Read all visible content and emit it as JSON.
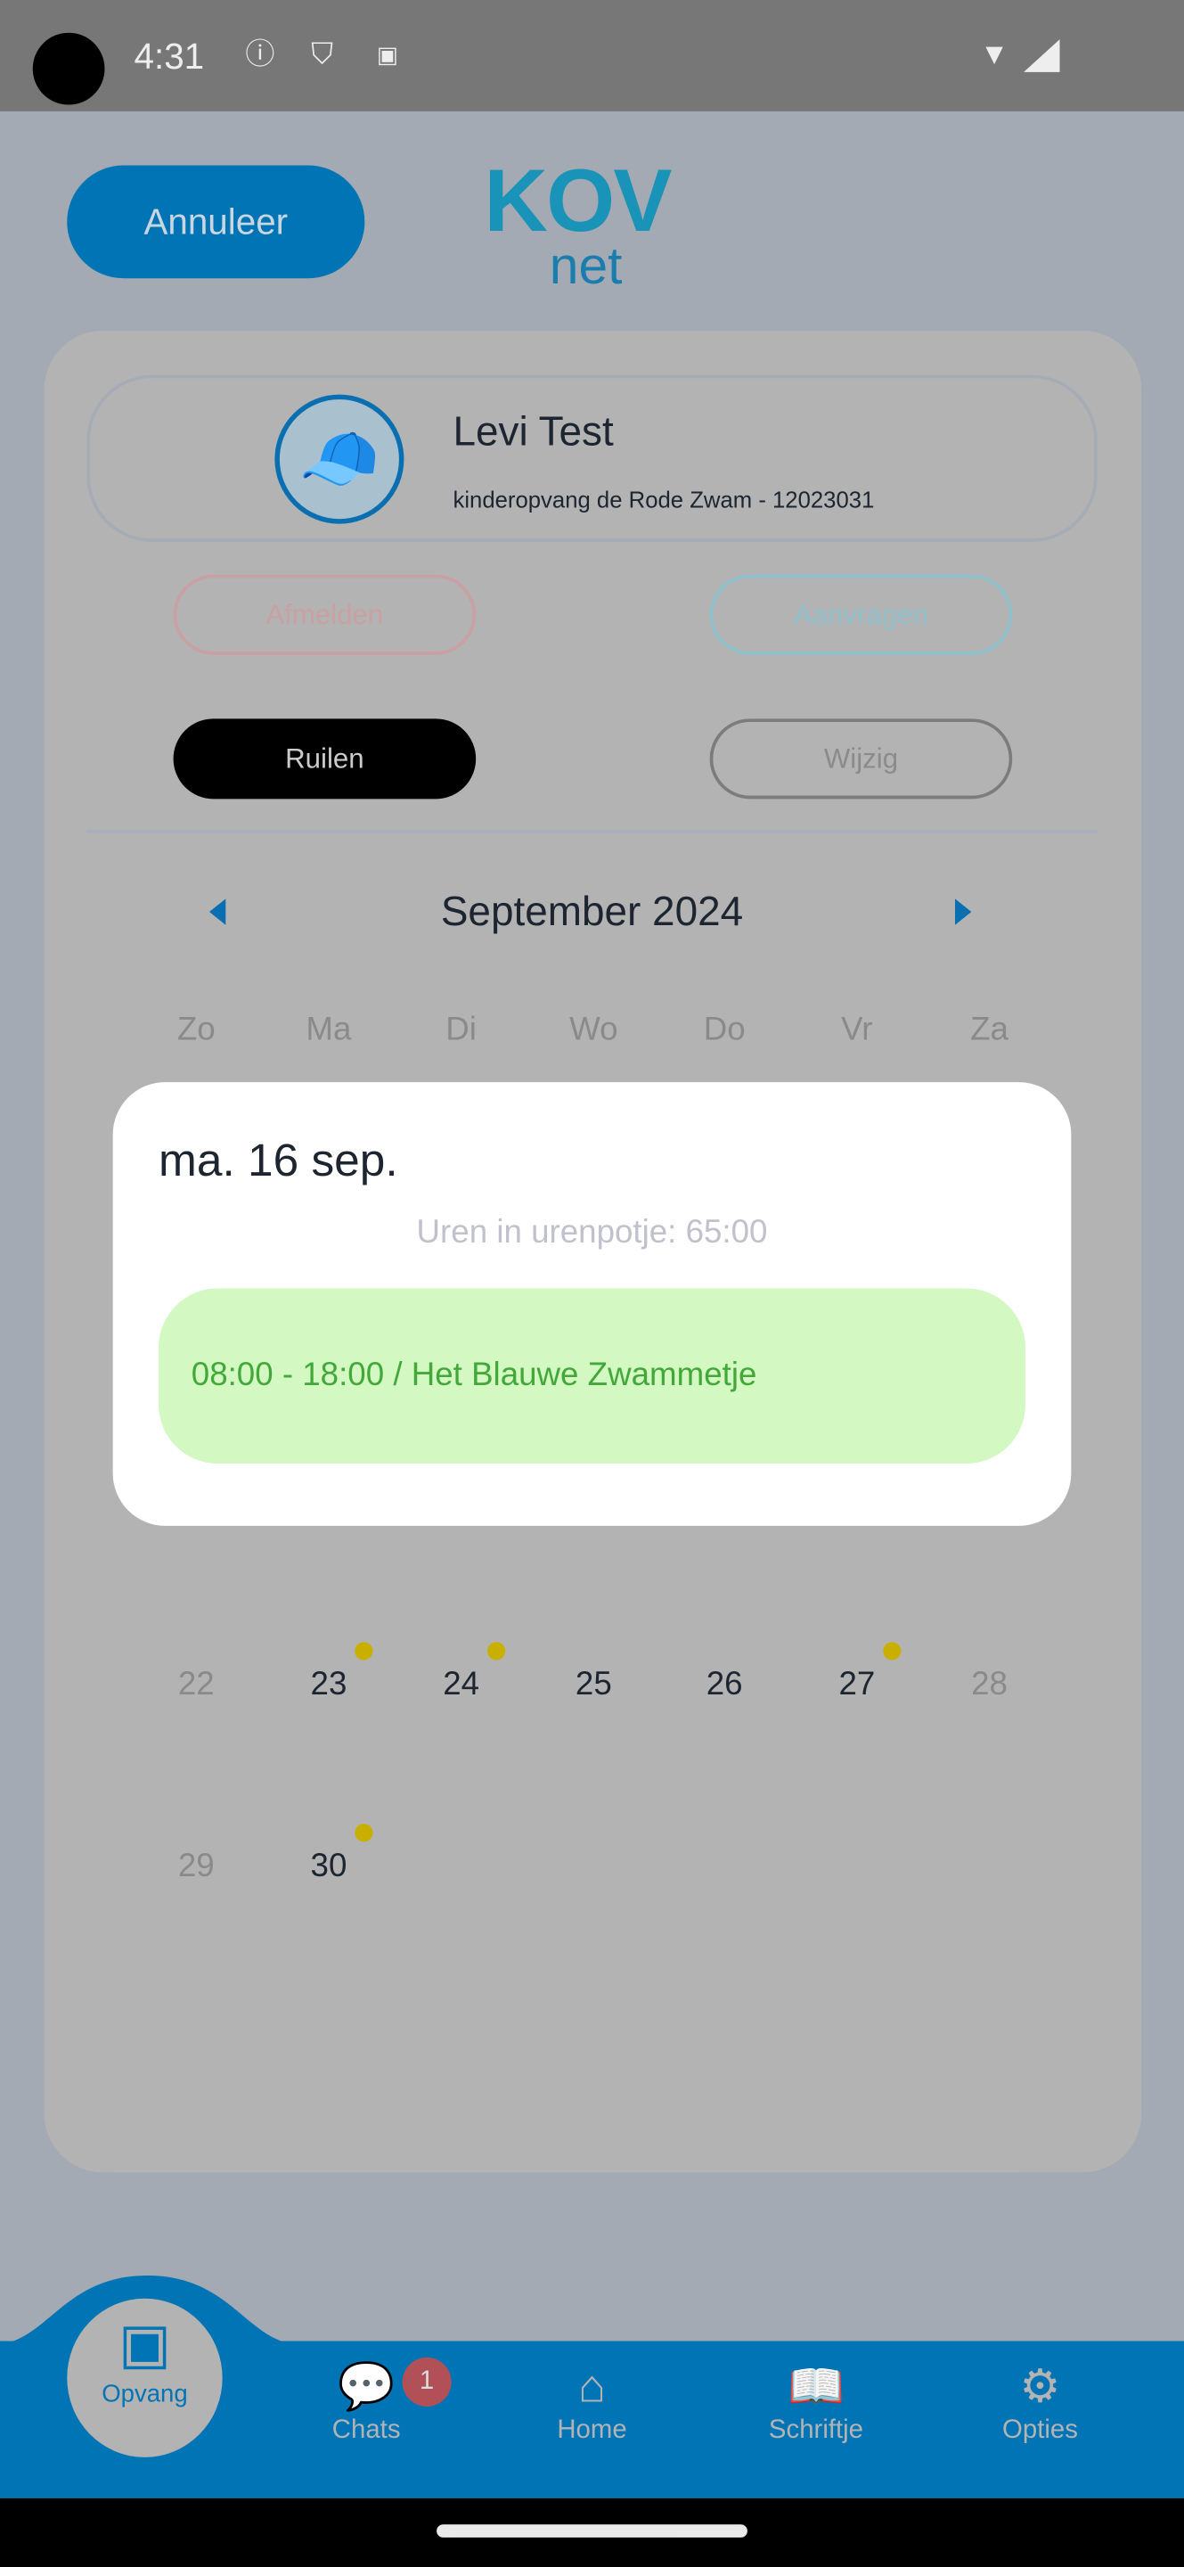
{
  "status_bar": {
    "time": "4:31",
    "icons": [
      "info-icon",
      "shield-icon",
      "accessibility-icon",
      "wifi-icon",
      "signal-icon"
    ]
  },
  "header": {
    "cancel_label": "Annuleer",
    "logo_top": "KOV",
    "logo_bottom": "net"
  },
  "profile": {
    "name": "Levi Test",
    "organization": "kinderopvang de Rode Zwam - 12023031"
  },
  "actions": {
    "afmelden": "Afmelden",
    "aanvragen": "Aanvragen",
    "ruilen": "Ruilen",
    "wijzig": "Wijzig"
  },
  "calendar": {
    "month": "September 2024",
    "weekdays": [
      "Zo",
      "Ma",
      "Di",
      "Wo",
      "Do",
      "Vr",
      "Za"
    ],
    "rows": [
      [
        {
          "d": "22",
          "we": true,
          "dot": false
        },
        {
          "d": "23",
          "dot": true
        },
        {
          "d": "24",
          "dot": true
        },
        {
          "d": "25",
          "dot": false
        },
        {
          "d": "26",
          "dot": false
        },
        {
          "d": "27",
          "dot": true
        },
        {
          "d": "28",
          "we": true,
          "dot": false
        }
      ],
      [
        {
          "d": "29",
          "we": true,
          "dot": false
        },
        {
          "d": "30",
          "dot": true
        }
      ]
    ]
  },
  "modal": {
    "date": "ma. 16 sep.",
    "hours": "Uren in urenpotje: 65:00",
    "slot": "08:00 - 18:00 / Het Blauwe Zwammetje"
  },
  "bottom_nav": {
    "items": [
      {
        "label": "Opvang",
        "icon": "calendar-icon",
        "active": true
      },
      {
        "label": "Chats",
        "icon": "chat-icon",
        "badge": "1"
      },
      {
        "label": "Home",
        "icon": "home-icon"
      },
      {
        "label": "Schriftje",
        "icon": "book-icon"
      },
      {
        "label": "Opties",
        "icon": "gear-icon"
      }
    ]
  },
  "colors": {
    "primary": "#0074b4",
    "slot_bg": "#d3f8c1",
    "slot_text": "#43a83a",
    "dot": "#c9b000",
    "badge": "#b25058"
  }
}
